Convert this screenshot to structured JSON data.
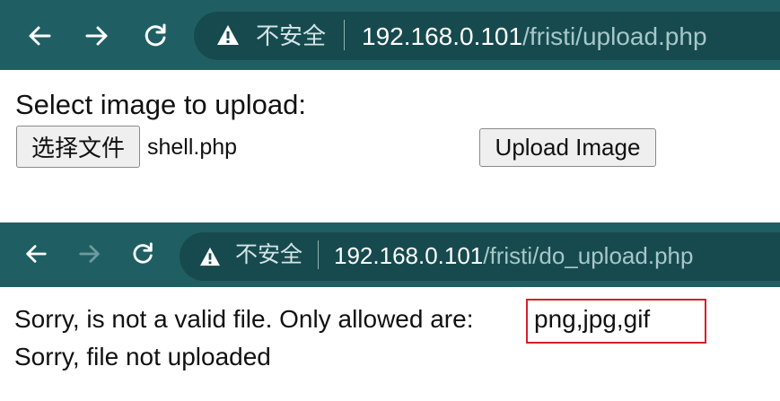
{
  "window1": {
    "security_label": "不安全",
    "url_host": "192.168.0.101",
    "url_path": "/fristi/upload.php"
  },
  "upload_form": {
    "heading": "Select image to upload:",
    "choose_file_label": "选择文件",
    "selected_file": "shell.php",
    "submit_label": "Upload Image"
  },
  "window2": {
    "security_label": "不安全",
    "url_host": "192.168.0.101",
    "url_path": "/fristi/do_upload.php"
  },
  "result": {
    "line1_prefix": "Sorry, is not a valid file. Only allowed are:",
    "allowed_types": "png,jpg,gif",
    "line2": "Sorry, file not uploaded"
  },
  "colors": {
    "toolbar": "#1f5f63",
    "highlight_box": "#d4202a"
  }
}
